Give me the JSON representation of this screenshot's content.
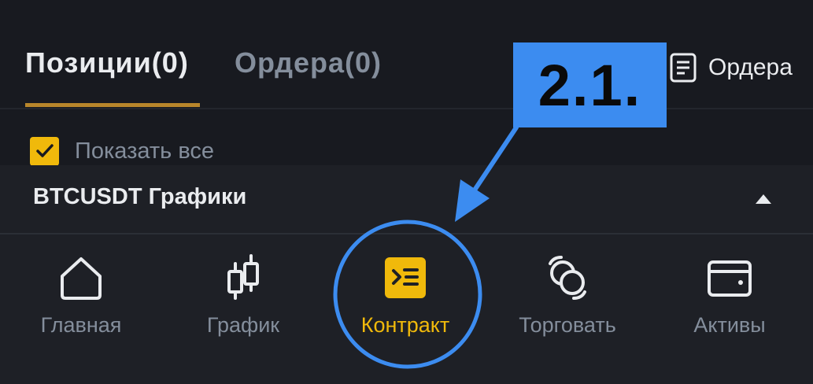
{
  "tabs": {
    "positions_label": "Позиции(0)",
    "orders_label": "Ордера(0)"
  },
  "orders_link": {
    "label": "Ордера",
    "icon": "document-list-icon"
  },
  "filter": {
    "show_all_label": "Показать все",
    "show_all_checked": true
  },
  "chart_section": {
    "title": "BTCUSDT Графики",
    "icon": "caret-up-icon"
  },
  "bottom_nav": {
    "items": [
      {
        "label": "Главная",
        "icon": "home-icon"
      },
      {
        "label": "График",
        "icon": "candlestick-icon"
      },
      {
        "label": "Контракт",
        "icon": "futures-contract-icon",
        "active": true
      },
      {
        "label": "Торговать",
        "icon": "trade-exchange-icon"
      },
      {
        "label": "Активы",
        "icon": "wallet-icon"
      }
    ]
  },
  "annotation": {
    "step_label": "2.1."
  },
  "colors": {
    "background": "#181a20",
    "panel": "#1e2026",
    "accent": "#f0b90b",
    "tab_underline": "#b8862b",
    "text_primary": "#eaecef",
    "text_secondary": "#848e9c",
    "annotation_blue": "#3c8cf0"
  }
}
